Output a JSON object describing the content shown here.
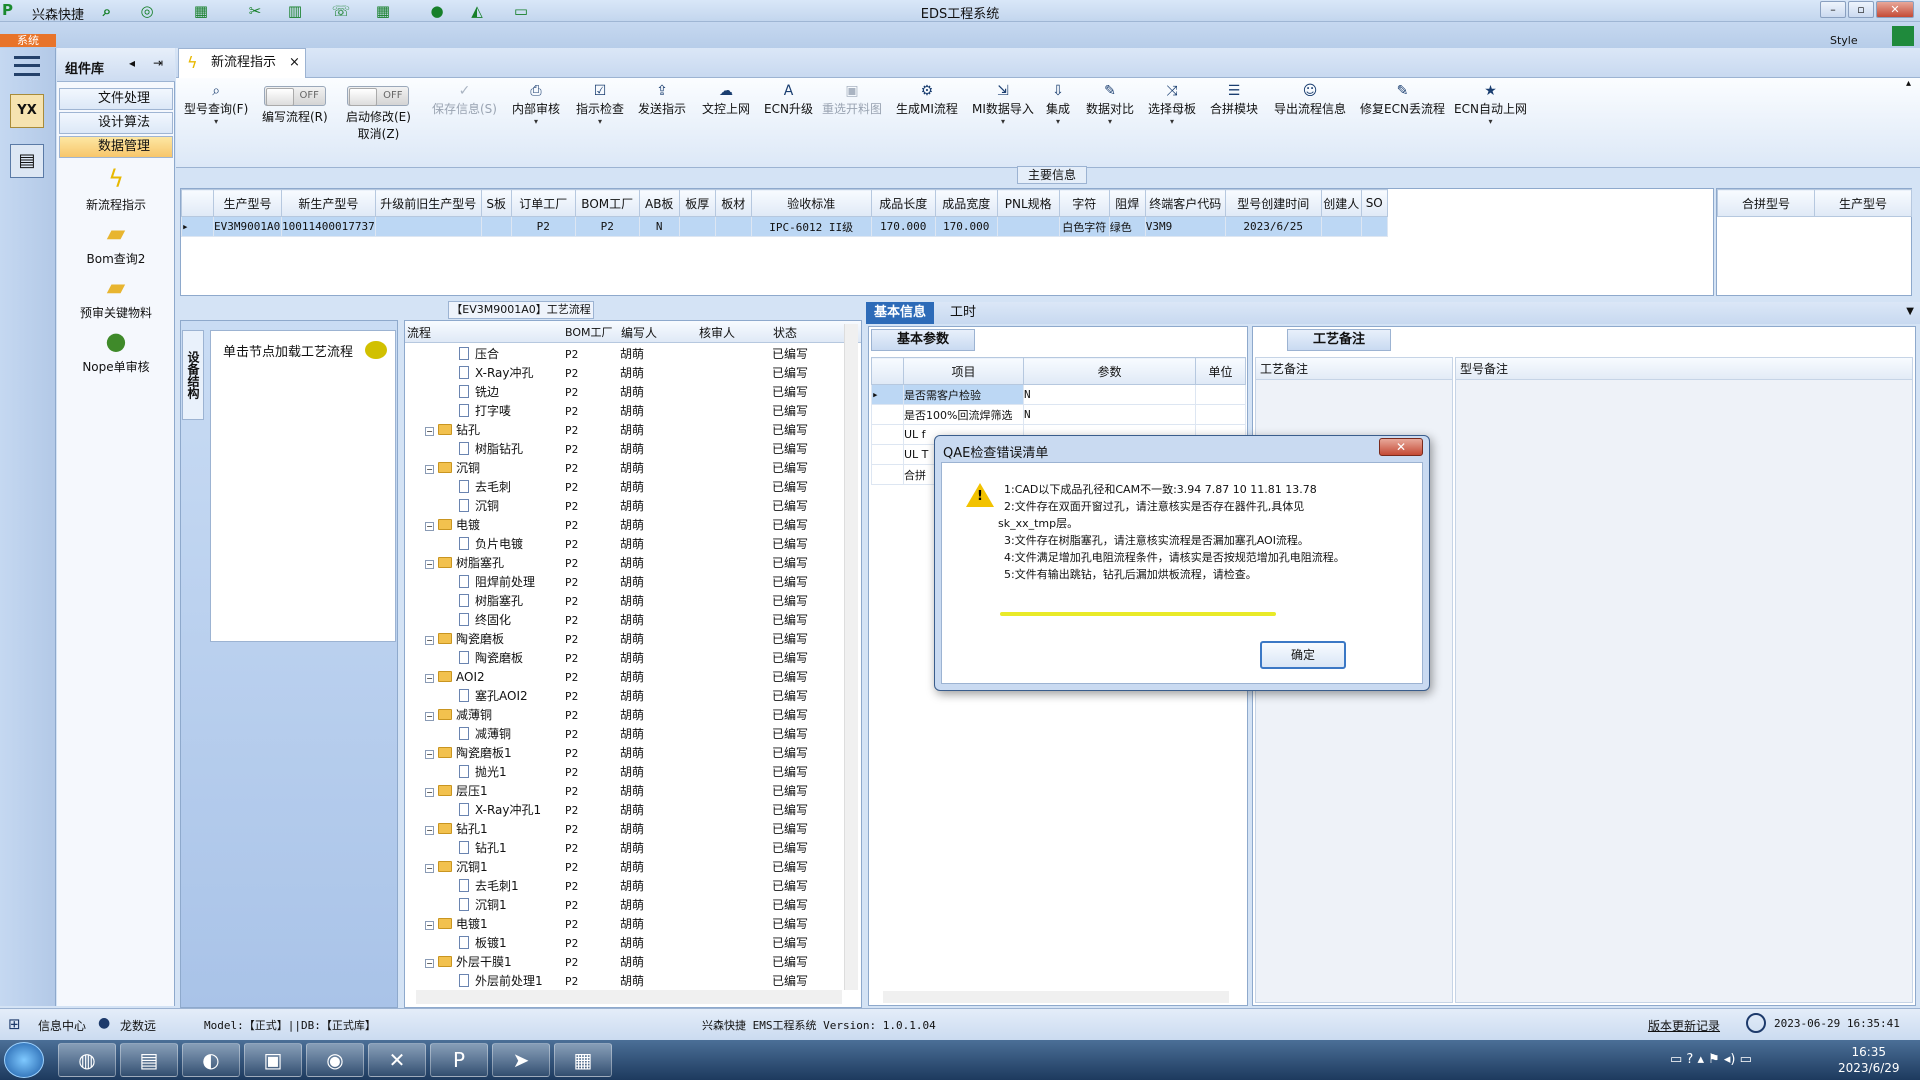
{
  "titlebar": {
    "app": "兴森快捷",
    "title": "EDS工程系统",
    "min": "–",
    "max": "▫",
    "close": "✕"
  },
  "sysbar": {
    "tab": "系统",
    "style": "Style"
  },
  "component": {
    "title": "组件库"
  },
  "nav": [
    {
      "label": "文件处理"
    },
    {
      "label": "设计算法"
    },
    {
      "label": "数据管理"
    }
  ],
  "tools": [
    {
      "label": "新流程指示"
    },
    {
      "label": "Bom查询2"
    },
    {
      "label": "预审关键物料"
    },
    {
      "label": "Nope单审核"
    }
  ],
  "doc_tab": {
    "label": "新流程指示",
    "close": "×"
  },
  "ribbon": [
    {
      "label": "型号查询(F)",
      "icon": "search"
    },
    {
      "label": "编写流程(R)",
      "icon": "toggle",
      "toggle": "OFF"
    },
    {
      "label": "启动修改(E)",
      "label2": "取消(Z)",
      "icon": "toggle",
      "toggle": "OFF"
    },
    {
      "label": "保存信息(S)",
      "icon": "check"
    },
    {
      "label": "内部审核",
      "icon": "print"
    },
    {
      "label": "指示检查",
      "icon": "check"
    },
    {
      "label": "发送指示",
      "icon": "upload"
    },
    {
      "label": "文控上网",
      "icon": "cloud"
    },
    {
      "label": "ECN升级",
      "icon": "A"
    },
    {
      "label": "重选开料图",
      "icon": "image"
    },
    {
      "label": "生成MI流程",
      "icon": "gear"
    },
    {
      "label": "MI数据导入",
      "icon": "import"
    },
    {
      "label": "集成",
      "icon": "download"
    },
    {
      "label": "数据对比",
      "icon": "wand"
    },
    {
      "label": "选择母板",
      "icon": "shuffle"
    },
    {
      "label": "合拼模块",
      "icon": "list"
    },
    {
      "label": "导出流程信息",
      "icon": "smile"
    },
    {
      "label": "修复ECN丢流程",
      "icon": "wrench"
    },
    {
      "label": "ECN自动上网",
      "icon": "star"
    }
  ],
  "main_info_label": "主要信息",
  "grid": {
    "headers": [
      "生产型号",
      "新生产型号",
      "升级前旧生产型号",
      "S板",
      "订单工厂",
      "BOM工厂",
      "AB板",
      "板厚",
      "板材",
      "验收标准",
      "成品长度",
      "成品宽度",
      "PNL规格",
      "字符",
      "阻焊",
      "终端客户代码",
      "型号创建时间",
      "创建人",
      "SO"
    ],
    "row": [
      "EV3M9001A0",
      "10011400017737",
      "",
      "",
      "P2",
      "P2",
      "N",
      "",
      "",
      "IPC-6012 II级",
      "170.000",
      "170.000",
      "",
      "白色字符",
      "绿色",
      "V3M9",
      "2023/6/25",
      "",
      ""
    ]
  },
  "merge_headers": [
    "合拼型号",
    "生产型号"
  ],
  "flow_title": "【EV3M9001A0】工艺流程",
  "left_pane": {
    "vtab": "设备结构",
    "hint": "单击节点加载工艺流程"
  },
  "tree": {
    "headers": [
      "流程",
      "BOM工厂",
      "编写人",
      "核审人",
      "状态"
    ],
    "rows": [
      {
        "name": "压合",
        "level": 2,
        "bom": "P2",
        "writer": "胡萌",
        "status": "已编写"
      },
      {
        "name": "X-Ray冲孔",
        "level": 2,
        "bom": "P2",
        "writer": "胡萌",
        "status": "已编写"
      },
      {
        "name": "铣边",
        "level": 2,
        "bom": "P2",
        "writer": "胡萌",
        "status": "已编写"
      },
      {
        "name": "打字唛",
        "level": 2,
        "bom": "P2",
        "writer": "胡萌",
        "status": "已编写"
      },
      {
        "name": "钻孔",
        "level": 1,
        "bom": "P2",
        "writer": "胡萌",
        "status": "已编写"
      },
      {
        "name": "树脂钻孔",
        "level": 2,
        "bom": "P2",
        "writer": "胡萌",
        "status": "已编写"
      },
      {
        "name": "沉铜",
        "level": 1,
        "bom": "P2",
        "writer": "胡萌",
        "status": "已编写"
      },
      {
        "name": "去毛刺",
        "level": 2,
        "bom": "P2",
        "writer": "胡萌",
        "status": "已编写"
      },
      {
        "name": "沉铜",
        "level": 2,
        "bom": "P2",
        "writer": "胡萌",
        "status": "已编写"
      },
      {
        "name": "电镀",
        "level": 1,
        "bom": "P2",
        "writer": "胡萌",
        "status": "已编写"
      },
      {
        "name": "负片电镀",
        "level": 2,
        "bom": "P2",
        "writer": "胡萌",
        "status": "已编写"
      },
      {
        "name": "树脂塞孔",
        "level": 1,
        "bom": "P2",
        "writer": "胡萌",
        "status": "已编写"
      },
      {
        "name": "阻焊前处理",
        "level": 2,
        "bom": "P2",
        "writer": "胡萌",
        "status": "已编写"
      },
      {
        "name": "树脂塞孔",
        "level": 2,
        "bom": "P2",
        "writer": "胡萌",
        "status": "已编写"
      },
      {
        "name": "终固化",
        "level": 2,
        "bom": "P2",
        "writer": "胡萌",
        "status": "已编写"
      },
      {
        "name": "陶瓷磨板",
        "level": 1,
        "bom": "P2",
        "writer": "胡萌",
        "status": "已编写"
      },
      {
        "name": "陶瓷磨板",
        "level": 2,
        "bom": "P2",
        "writer": "胡萌",
        "status": "已编写"
      },
      {
        "name": "AOI2",
        "level": 1,
        "bom": "P2",
        "writer": "胡萌",
        "status": "已编写"
      },
      {
        "name": "塞孔AOI2",
        "level": 2,
        "bom": "P2",
        "writer": "胡萌",
        "status": "已编写"
      },
      {
        "name": "减薄铜",
        "level": 1,
        "bom": "P2",
        "writer": "胡萌",
        "status": "已编写"
      },
      {
        "name": "减薄铜",
        "level": 2,
        "bom": "P2",
        "writer": "胡萌",
        "status": "已编写"
      },
      {
        "name": "陶瓷磨板1",
        "level": 1,
        "bom": "P2",
        "writer": "胡萌",
        "status": "已编写"
      },
      {
        "name": "抛光1",
        "level": 2,
        "bom": "P2",
        "writer": "胡萌",
        "status": "已编写"
      },
      {
        "name": "层压1",
        "level": 1,
        "bom": "P2",
        "writer": "胡萌",
        "status": "已编写"
      },
      {
        "name": "X-Ray冲孔1",
        "level": 2,
        "bom": "P2",
        "writer": "胡萌",
        "status": "已编写"
      },
      {
        "name": "钻孔1",
        "level": 1,
        "bom": "P2",
        "writer": "胡萌",
        "status": "已编写"
      },
      {
        "name": "钻孔1",
        "level": 2,
        "bom": "P2",
        "writer": "胡萌",
        "status": "已编写"
      },
      {
        "name": "沉铜1",
        "level": 1,
        "bom": "P2",
        "writer": "胡萌",
        "status": "已编写"
      },
      {
        "name": "去毛刺1",
        "level": 2,
        "bom": "P2",
        "writer": "胡萌",
        "status": "已编写"
      },
      {
        "name": "沉铜1",
        "level": 2,
        "bom": "P2",
        "writer": "胡萌",
        "status": "已编写"
      },
      {
        "name": "电镀1",
        "level": 1,
        "bom": "P2",
        "writer": "胡萌",
        "status": "已编写"
      },
      {
        "name": "板镀1",
        "level": 2,
        "bom": "P2",
        "writer": "胡萌",
        "status": "已编写"
      },
      {
        "name": "外层干膜1",
        "level": 1,
        "bom": "P2",
        "writer": "胡萌",
        "status": "已编写"
      },
      {
        "name": "外层前处理1",
        "level": 2,
        "bom": "P2",
        "writer": "胡萌",
        "status": "已编写"
      }
    ]
  },
  "right_tabs": [
    {
      "label": "基本信息"
    },
    {
      "label": "工时"
    }
  ],
  "basic": {
    "title": "基本参数",
    "headers": [
      "项目",
      "参数",
      "单位"
    ],
    "rows": [
      {
        "item": "是否需客户检验",
        "param": "N"
      },
      {
        "item": "是否100%回流焊筛选",
        "param": "N"
      },
      {
        "item": "UL f",
        "param": ""
      },
      {
        "item": "UL T",
        "param": ""
      },
      {
        "item": "合拼",
        "param": ""
      }
    ]
  },
  "notes": {
    "title": "工艺备注",
    "col1": "工艺备注",
    "col2": "型号备注"
  },
  "dialog": {
    "title": "QAE检查错误清单",
    "close": "✕",
    "lines": [
      "1:CAD以下成品孔径和CAM不一致:3.94 7.87 10 11.81 13.78",
      "2:文件存在双面开窗过孔，请注意核实是否存在器件孔,具体见",
      "sk_xx_tmp层。",
      "3:文件存在树脂塞孔，请注意核实流程是否漏加塞孔AOI流程。",
      "4:文件满足增加孔电阻流程条件，请核实是否按规范增加孔电阻流程。",
      "5:文件有输出跳钻，钻孔后漏加烘板流程，请检查。"
    ],
    "ok": "确定"
  },
  "status": {
    "info": "信息中心",
    "user": "龙数远",
    "model": "Model:【正式】||DB:【正式库】",
    "version": "兴森快捷 EMS工程系统 Version: 1.0.1.04",
    "update": "版本更新记录",
    "datetime": "2023-06-29 16:35:41"
  },
  "clock": {
    "time": "16:35",
    "date": "2023/6/29"
  }
}
